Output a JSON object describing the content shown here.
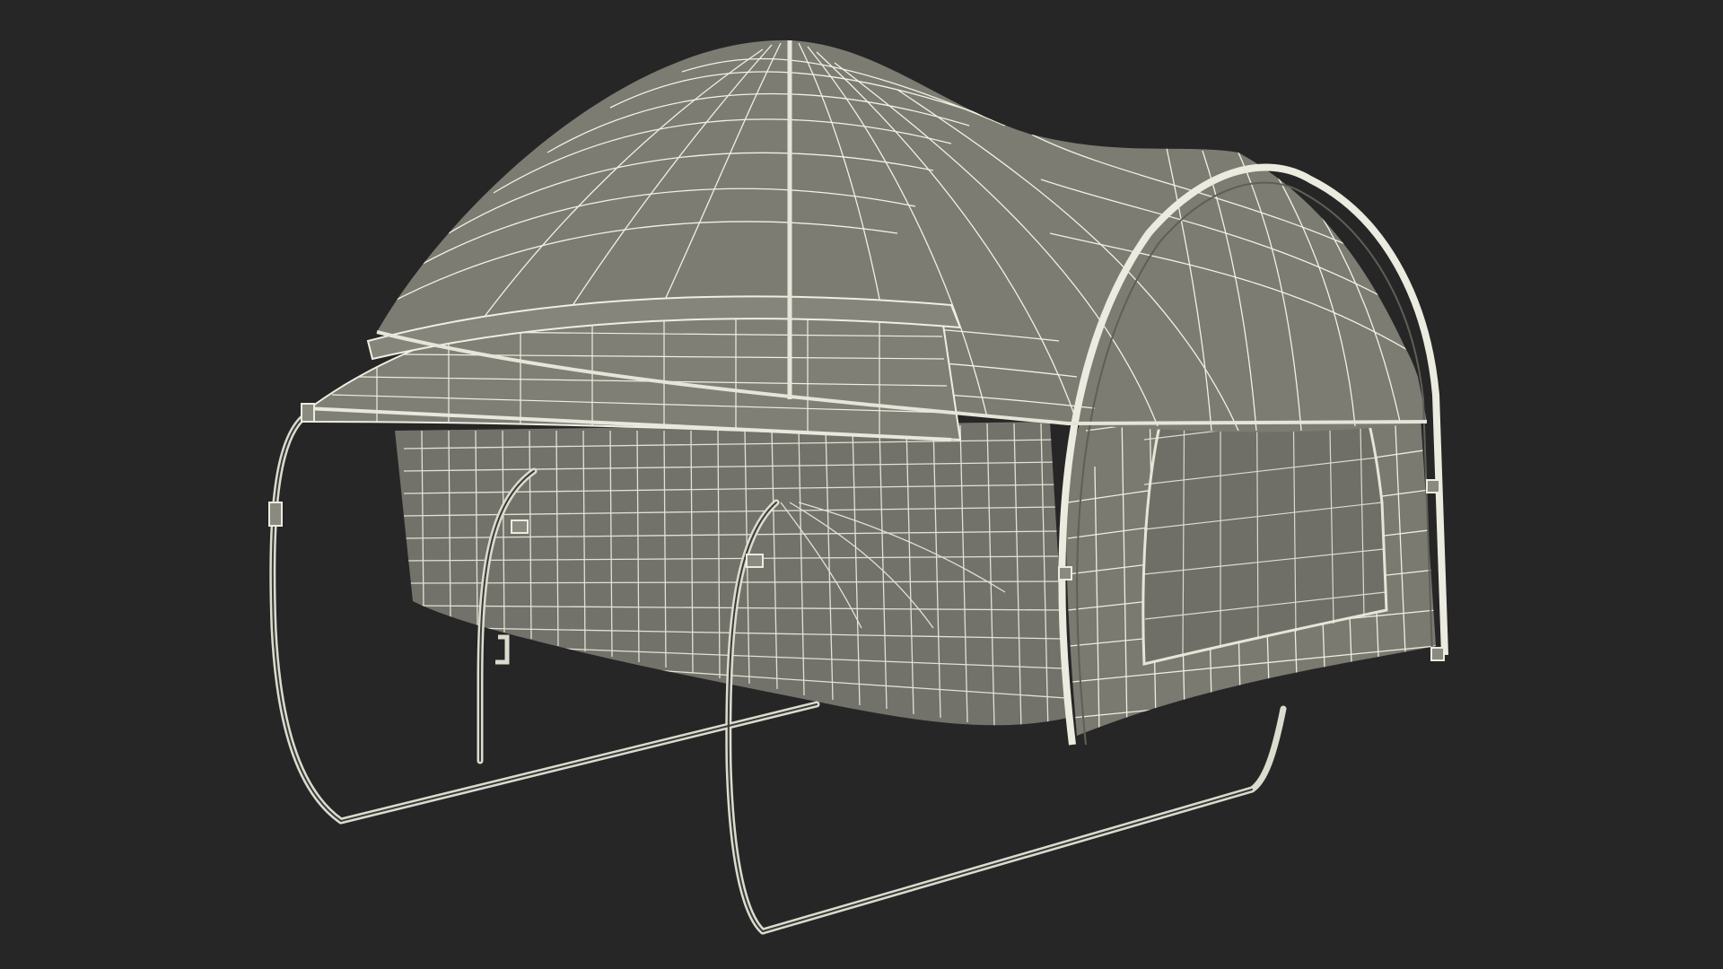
{
  "scene": {
    "subject": "pickup-truck-bed-tent-wireframe",
    "colors": {
      "background": "#262626",
      "fabric_fill": "#7b7b72",
      "fabric_shadow": "#6c6c64",
      "wire": "#f1f0e4",
      "frame": "#d8d8cc"
    }
  }
}
